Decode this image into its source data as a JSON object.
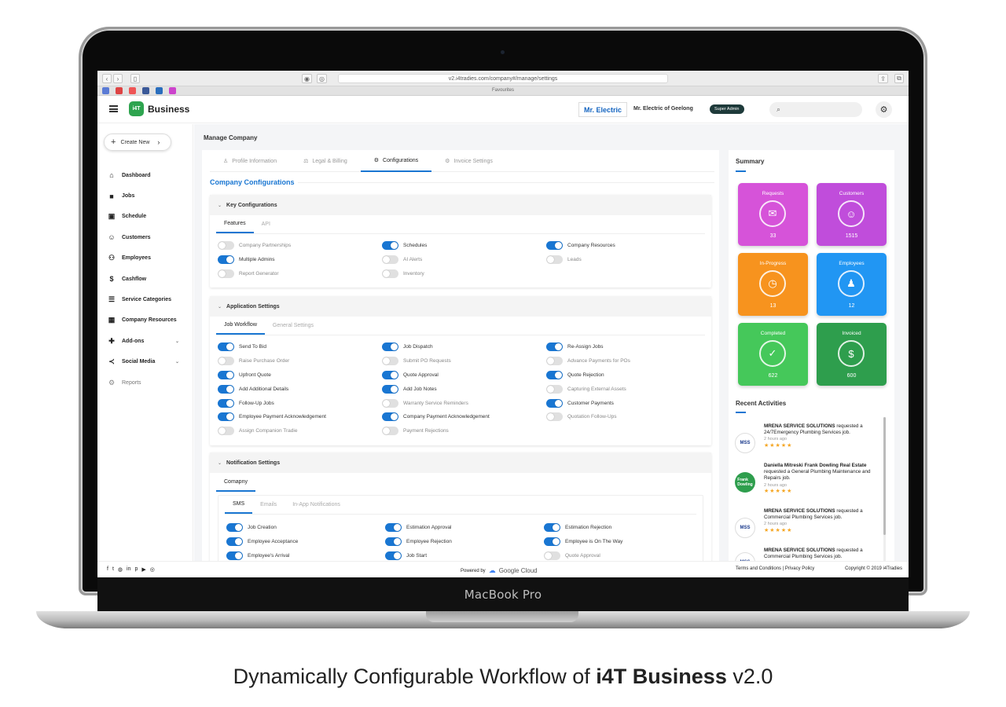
{
  "device": {
    "label": "MacBook Pro"
  },
  "caption": {
    "before": "Dynamically Configurable Workflow of ",
    "brand": "i4T Business",
    "after": " v2.0"
  },
  "browser": {
    "url": "v2.i4tradies.com/company#/manage/settings",
    "favourites_title": "Favourites"
  },
  "header": {
    "brand": "Business",
    "logo_text": "i4T",
    "company_logo": "Mr. Electric",
    "company_name": "Mr. Electric of Geelong",
    "role": "Super Admin"
  },
  "sidebar": {
    "create_label": "Create New",
    "items": [
      {
        "label": "Dashboard",
        "icon": "home-icon"
      },
      {
        "label": "Jobs",
        "icon": "briefcase-icon"
      },
      {
        "label": "Schedule",
        "icon": "calendar-icon"
      },
      {
        "label": "Customers",
        "icon": "smiley-icon"
      },
      {
        "label": "Employees",
        "icon": "people-icon"
      },
      {
        "label": "Cashflow",
        "icon": "dollar-icon"
      },
      {
        "label": "Service Categories",
        "icon": "list-icon"
      },
      {
        "label": "Company Resources",
        "icon": "grid-icon"
      },
      {
        "label": "Add-ons",
        "icon": "puzzle-icon"
      },
      {
        "label": "Social Media",
        "icon": "share-icon"
      },
      {
        "label": "Reports",
        "icon": "gear-icon"
      }
    ]
  },
  "main": {
    "page_title": "Manage Company",
    "tabs": [
      {
        "label": "Profile Information"
      },
      {
        "label": "Legal & Billing"
      },
      {
        "label": "Configurations"
      },
      {
        "label": "Invoice Settings"
      }
    ],
    "section_title": "Company Configurations",
    "key_config": {
      "title": "Key Configurations",
      "subtabs": [
        "Features",
        "API"
      ],
      "toggles": [
        {
          "label": "Company Partnerships",
          "on": false
        },
        {
          "label": "Schedules",
          "on": true
        },
        {
          "label": "Company Resources",
          "on": true
        },
        {
          "label": "Multiple Admins",
          "on": true
        },
        {
          "label": "AI Alerts",
          "on": false
        },
        {
          "label": "Leads",
          "on": false
        },
        {
          "label": "Report Generator",
          "on": false
        },
        {
          "label": "Inventory",
          "on": false
        }
      ]
    },
    "app_settings": {
      "title": "Application Settings",
      "subtabs": [
        "Job Workflow",
        "General Settings"
      ],
      "toggles": [
        {
          "label": "Send To Bid",
          "on": true
        },
        {
          "label": "Job Dispatch",
          "on": true
        },
        {
          "label": "Re-Assign Jobs",
          "on": true
        },
        {
          "label": "Raise Purchase Order",
          "on": false
        },
        {
          "label": "Submit PO Requests",
          "on": false
        },
        {
          "label": "Advance Payments for POs",
          "on": false
        },
        {
          "label": "Upfront Quote",
          "on": true
        },
        {
          "label": "Quote Approval",
          "on": true
        },
        {
          "label": "Quote Rejection",
          "on": true
        },
        {
          "label": "Add Additional Details",
          "on": true
        },
        {
          "label": "Add Job Notes",
          "on": true
        },
        {
          "label": "Capturing External Assets",
          "on": false
        },
        {
          "label": "Follow-Up Jobs",
          "on": true
        },
        {
          "label": "Warranty Service Reminders",
          "on": false
        },
        {
          "label": "Customer Payments",
          "on": true
        },
        {
          "label": "Employee Payment Acknowledgement",
          "on": true
        },
        {
          "label": "Company Payment Acknowledgement",
          "on": true
        },
        {
          "label": "Quotation Follow-Ups",
          "on": false
        },
        {
          "label": "Assign Companion Tradie",
          "on": false
        },
        {
          "label": "Payment Rejections",
          "on": false
        }
      ]
    },
    "notification_settings": {
      "title": "Notification Settings",
      "subtab": "Comapny",
      "channels": [
        "SMS",
        "Emails",
        "In-App Notifications"
      ],
      "toggles": [
        {
          "label": "Job Creation",
          "on": true
        },
        {
          "label": "Estimation Approval",
          "on": true
        },
        {
          "label": "Estimation Rejection",
          "on": true
        },
        {
          "label": "Employee Acceptance",
          "on": true
        },
        {
          "label": "Employee Rejection",
          "on": true
        },
        {
          "label": "Employee is On The Way",
          "on": true
        },
        {
          "label": "Employee's Arrival",
          "on": true
        },
        {
          "label": "Job Start",
          "on": true
        },
        {
          "label": "Quote Approval",
          "on": false
        }
      ]
    }
  },
  "summary": {
    "title": "Summary",
    "tiles": [
      {
        "label": "Requests",
        "value": "33",
        "color": "#d653d9",
        "icon": "inbox-icon"
      },
      {
        "label": "Customers",
        "value": "1515",
        "color": "#c04ddb",
        "icon": "user-icon"
      },
      {
        "label": "In-Progress",
        "value": "13",
        "color": "#f7931e",
        "icon": "clock-icon"
      },
      {
        "label": "Employees",
        "value": "12",
        "color": "#2196f3",
        "icon": "worker-icon"
      },
      {
        "label": "Completed",
        "value": "622",
        "color": "#45c85a",
        "icon": "check-icon"
      },
      {
        "label": "Invoiced",
        "value": "600",
        "color": "#2e9e4d",
        "icon": "money-icon"
      }
    ],
    "recent_title": "Recent Activities",
    "activities": [
      {
        "name": "MRENA SERVICE SOLUTIONS",
        "text": "requested a 24/7Emergency Plumbing Services job.",
        "time": "2 hours ago",
        "avatar": "MSS"
      },
      {
        "name": "Daniella Mitreski Frank Dowling Real Estate",
        "text": "requested a General Plumbing Maintenance and Repairs job.",
        "time": "2 hours ago",
        "avatar": "Frank Dowling"
      },
      {
        "name": "MRENA SERVICE SOLUTIONS",
        "text": "requested a Commercial Plumbing Services job.",
        "time": "2 hours ago",
        "avatar": "MSS"
      },
      {
        "name": "MRENA SERVICE SOLUTIONS",
        "text": "requested a Commercial Plumbing Services job.",
        "time": "",
        "avatar": "MSS"
      }
    ],
    "stars": "★★★★★"
  },
  "footer": {
    "powered": "Powered by",
    "cloud": "Google Cloud",
    "links": "Terms and Conditions  |  Privacy Policy",
    "copyright": "Copyright © 2019  i4Tradies"
  }
}
